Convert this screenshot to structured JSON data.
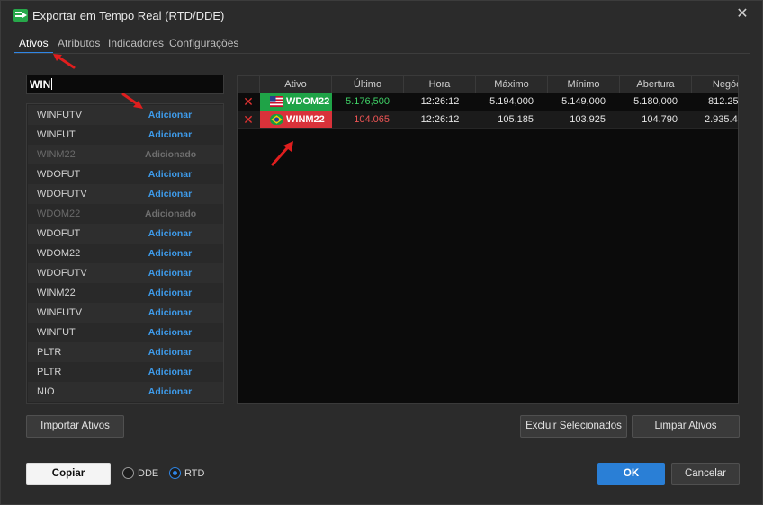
{
  "window": {
    "title": "Exportar em Tempo Real (RTD/DDE)"
  },
  "tabs": [
    {
      "label": "Ativos",
      "active": true
    },
    {
      "label": "Atributos"
    },
    {
      "label": "Indicadores"
    },
    {
      "label": "Configurações"
    }
  ],
  "search": {
    "value": "WIN"
  },
  "asset_list": [
    {
      "symbol": "WINFUTV",
      "action": "Adicionar"
    },
    {
      "symbol": "WINFUT",
      "action": "Adicionar"
    },
    {
      "symbol": "WINM22",
      "action": "Adicionado",
      "disabled": true
    },
    {
      "symbol": "WDOFUT",
      "action": "Adicionar"
    },
    {
      "symbol": "WDOFUTV",
      "action": "Adicionar"
    },
    {
      "symbol": "WDOM22",
      "action": "Adicionado",
      "disabled": true
    },
    {
      "symbol": "WDOFUT",
      "action": "Adicionar"
    },
    {
      "symbol": "WDOM22",
      "action": "Adicionar"
    },
    {
      "symbol": "WDOFUTV",
      "action": "Adicionar"
    },
    {
      "symbol": "WINM22",
      "action": "Adicionar"
    },
    {
      "symbol": "WINFUTV",
      "action": "Adicionar"
    },
    {
      "symbol": "WINFUT",
      "action": "Adicionar"
    },
    {
      "symbol": "PLTR",
      "action": "Adicionar"
    },
    {
      "symbol": "PLTR",
      "action": "Adicionar"
    },
    {
      "symbol": "NIO",
      "action": "Adicionar"
    }
  ],
  "grid": {
    "columns": [
      "",
      "Ativo",
      "Último",
      "Hora",
      "Máximo",
      "Mínimo",
      "Abertura",
      "Negóci"
    ],
    "rows": [
      {
        "asset": "WDOM22",
        "flag": "us-flag-icon",
        "asset_color": "#1fa347",
        "ultimo": "5.176,500",
        "ultimo_color": "#3fd066",
        "hora": "12:26:12",
        "maximo": "5.194,000",
        "minimo": "5.149,000",
        "abertura": "5.180,000",
        "negocios": "812.25"
      },
      {
        "asset": "WINM22",
        "flag": "brazil-flag-icon",
        "asset_color": "#d9323a",
        "ultimo": "104.065",
        "ultimo_color": "#ec5454",
        "hora": "12:26:12",
        "maximo": "105.185",
        "minimo": "103.925",
        "abertura": "104.790",
        "negocios": "2.935.4"
      }
    ]
  },
  "buttons": {
    "import": "Importar Ativos",
    "delete_selected": "Excluir Selecionados",
    "clear": "Limpar Ativos",
    "copy": "Copiar",
    "ok": "OK",
    "cancel": "Cancelar"
  },
  "mode": {
    "options": [
      "DDE",
      "RTD"
    ],
    "selected": "RTD"
  },
  "colors": {
    "accent": "#2f86e6",
    "link": "#3e9bea",
    "annotation_arrow": "#e01e1e"
  }
}
